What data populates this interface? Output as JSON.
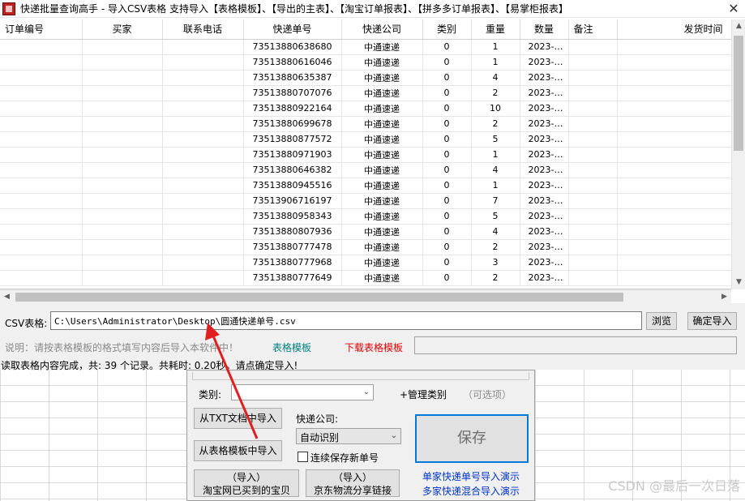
{
  "window": {
    "title": "快递批量查询高手 - 导入CSV表格  支持导入【表格模板】、【导出的主表】、【淘宝订单报表】、【拼多多订单报表】、【易掌柜报表】",
    "close_glyph": "✕"
  },
  "grid": {
    "columns": [
      "订单编号",
      "买家",
      "联系电话",
      "快递单号",
      "快递公司",
      "类别",
      "重量",
      "数量",
      "备注",
      "发货时间"
    ],
    "rows": [
      [
        "",
        "",
        "",
        "73513880638680",
        "中通速递",
        "0",
        "1",
        "2023-…",
        "",
        ""
      ],
      [
        "",
        "",
        "",
        "73513880616046",
        "中通速递",
        "0",
        "1",
        "2023-…",
        "",
        ""
      ],
      [
        "",
        "",
        "",
        "73513880635387",
        "中通速递",
        "0",
        "4",
        "2023-…",
        "",
        ""
      ],
      [
        "",
        "",
        "",
        "73513880707076",
        "中通速递",
        "0",
        "2",
        "2023-…",
        "",
        ""
      ],
      [
        "",
        "",
        "",
        "73513880922164",
        "中通速递",
        "0",
        "10",
        "2023-…",
        "",
        ""
      ],
      [
        "",
        "",
        "",
        "73513880699678",
        "中通速递",
        "0",
        "2",
        "2023-…",
        "",
        ""
      ],
      [
        "",
        "",
        "",
        "73513880877572",
        "中通速递",
        "0",
        "5",
        "2023-…",
        "",
        ""
      ],
      [
        "",
        "",
        "",
        "73513880971903",
        "中通速递",
        "0",
        "1",
        "2023-…",
        "",
        ""
      ],
      [
        "",
        "",
        "",
        "73513880646382",
        "中通速递",
        "0",
        "4",
        "2023-…",
        "",
        ""
      ],
      [
        "",
        "",
        "",
        "73513880945516",
        "中通速递",
        "0",
        "1",
        "2023-…",
        "",
        ""
      ],
      [
        "",
        "",
        "",
        "73513906716197",
        "中通速递",
        "0",
        "7",
        "2023-…",
        "",
        ""
      ],
      [
        "",
        "",
        "",
        "73513880958343",
        "中通速递",
        "0",
        "5",
        "2023-…",
        "",
        ""
      ],
      [
        "",
        "",
        "",
        "73513880807936",
        "中通速递",
        "0",
        "4",
        "2023-…",
        "",
        ""
      ],
      [
        "",
        "",
        "",
        "73513880777478",
        "中通速递",
        "0",
        "2",
        "2023-…",
        "",
        ""
      ],
      [
        "",
        "",
        "",
        "73513880777968",
        "中通速递",
        "0",
        "3",
        "2023-…",
        "",
        ""
      ],
      [
        "",
        "",
        "",
        "73513880777649",
        "中通速递",
        "0",
        "2",
        "2023-…",
        "",
        ""
      ]
    ]
  },
  "import_panel": {
    "csv_label": "CSV表格:",
    "csv_path": "C:\\Users\\Administrator\\Desktop\\圆通快递单号.csv",
    "browse_label": "浏览",
    "confirm_label": "确定导入",
    "hint": "说明：请按表格模板的格式填写内容后导入本软件中！",
    "template_link": "表格模板",
    "download_template_link": "下载表格模板",
    "status": "读取表格内容完成，共: 39 个记录。共耗时: 0.20秒。请点确定导入!"
  },
  "dialog": {
    "category_label": "类别:",
    "category_value": "",
    "manage_category": "+管理类别",
    "optional": "（可选项）",
    "import_txt": "从TXT文档中导入",
    "courier_label": "快递公司:",
    "courier_value": "自动识别",
    "import_template": "从表格模板中导入",
    "continuous_save": "连续保存新单号",
    "save_label": "保存",
    "taobao_line1": "（导入）",
    "taobao_line2": "淘宝网已买到的宝贝",
    "jd_line1": "（导入）",
    "jd_line2": "京东物流分享链接",
    "demo_single": "单家快递单号导入演示",
    "demo_multi": "多家快递混合导入演示"
  },
  "watermark": "CSDN @最后一次日落",
  "colors": {
    "accent_blue": "#0078d7",
    "link_teal": "#008080",
    "link_red": "#e00000",
    "arrow_red": "#e02020"
  }
}
